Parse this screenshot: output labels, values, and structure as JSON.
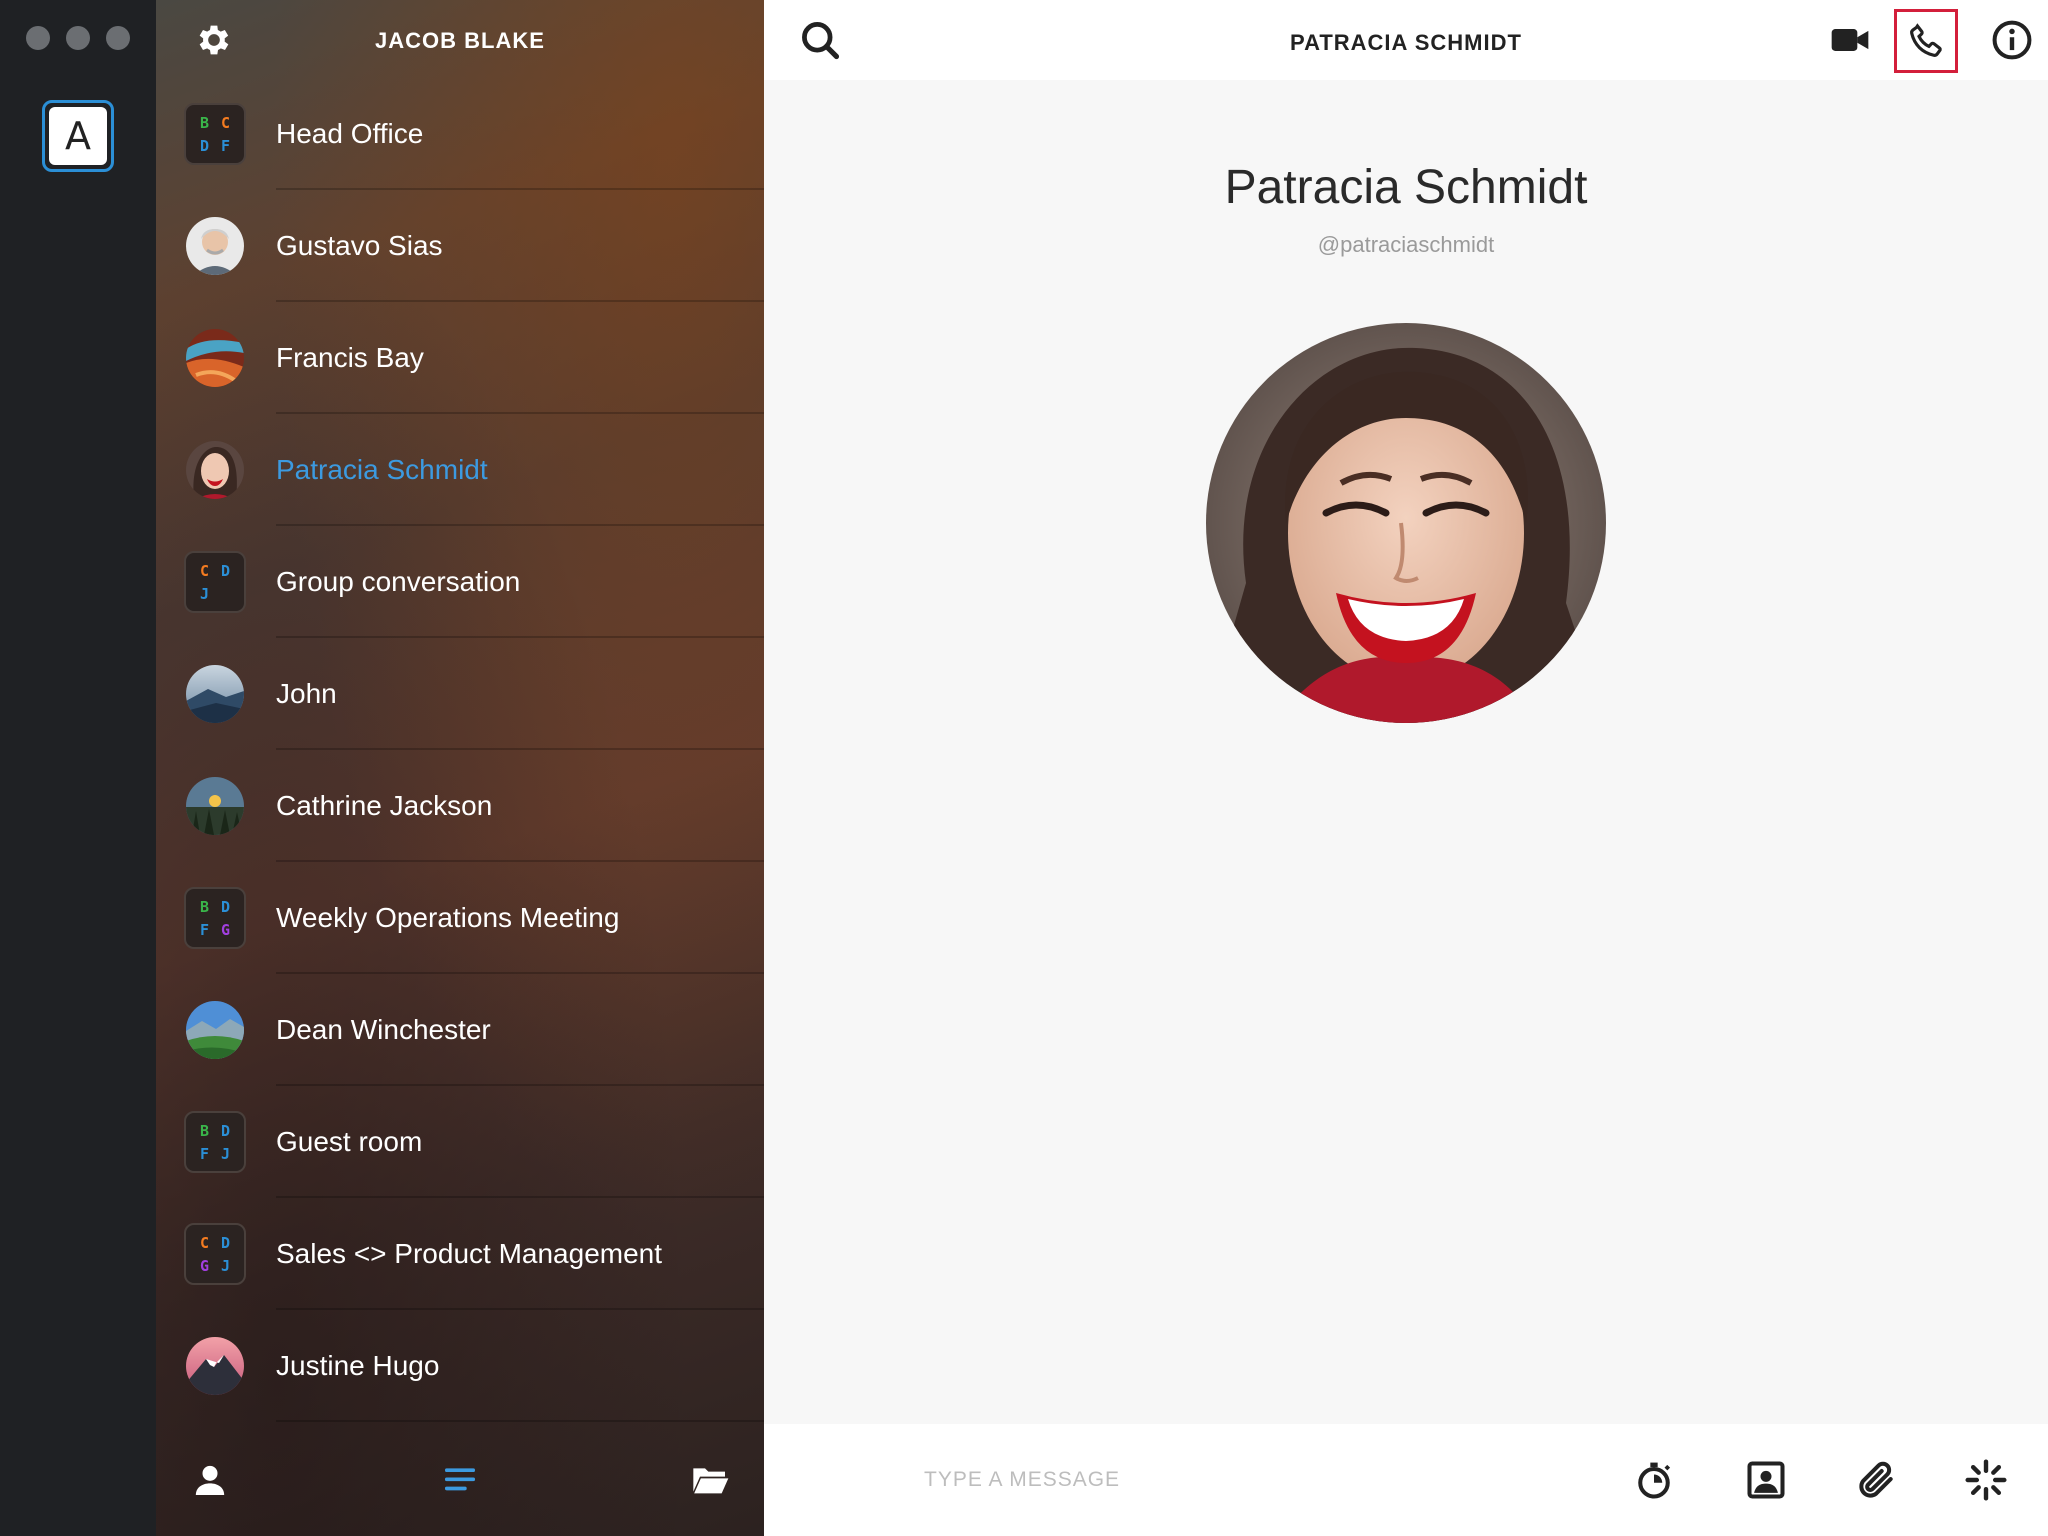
{
  "window": {
    "account_initial": "A"
  },
  "sidebar": {
    "title": "JACOB BLAKE",
    "items": [
      {
        "type": "group",
        "label": "Head Office",
        "letters": [
          "B",
          "C",
          "D",
          "F"
        ],
        "colors": [
          "#3ab54a",
          "#f47b20",
          "#2b8fd6",
          "#2b8fd6"
        ]
      },
      {
        "type": "person",
        "label": "Gustavo Sias",
        "avatar": "older-man"
      },
      {
        "type": "person",
        "label": "Francis Bay",
        "avatar": "canyon"
      },
      {
        "type": "person",
        "label": "Patracia Schmidt",
        "avatar": "woman",
        "active": true
      },
      {
        "type": "group",
        "label": "Group conversation",
        "letters": [
          "C",
          "D",
          "J",
          ""
        ],
        "colors": [
          "#f47b20",
          "#2b8fd6",
          "#2b8fd6",
          ""
        ]
      },
      {
        "type": "person",
        "label": "John",
        "avatar": "mountain-mist"
      },
      {
        "type": "person",
        "label": "Cathrine Jackson",
        "avatar": "forest-sunset"
      },
      {
        "type": "group",
        "label": "Weekly Operations Meeting",
        "letters": [
          "B",
          "D",
          "F",
          "G"
        ],
        "colors": [
          "#3ab54a",
          "#2b8fd6",
          "#2b8fd6",
          "#a23fe0"
        ]
      },
      {
        "type": "person",
        "label": "Dean Winchester",
        "avatar": "valley"
      },
      {
        "type": "group",
        "label": "Guest room",
        "letters": [
          "B",
          "D",
          "F",
          "J"
        ],
        "colors": [
          "#3ab54a",
          "#2b8fd6",
          "#2b8fd6",
          "#2b8fd6"
        ]
      },
      {
        "type": "group",
        "label": "Sales <> Product Management",
        "letters": [
          "C",
          "D",
          "G",
          "J"
        ],
        "colors": [
          "#f47b20",
          "#2b8fd6",
          "#a23fe0",
          "#2b8fd6"
        ]
      },
      {
        "type": "person",
        "label": "Justine Hugo",
        "avatar": "pink-peak"
      }
    ]
  },
  "main": {
    "title": "PATRACIA SCHMIDT",
    "profile_name": "Patracia Schmidt",
    "profile_handle": "@patraciaschmidt",
    "message_placeholder": "TYPE A MESSAGE"
  },
  "colors": {
    "accent": "#2b8fd6",
    "active_text": "#3c9ae0",
    "call_highlight": "#d31f3b"
  }
}
